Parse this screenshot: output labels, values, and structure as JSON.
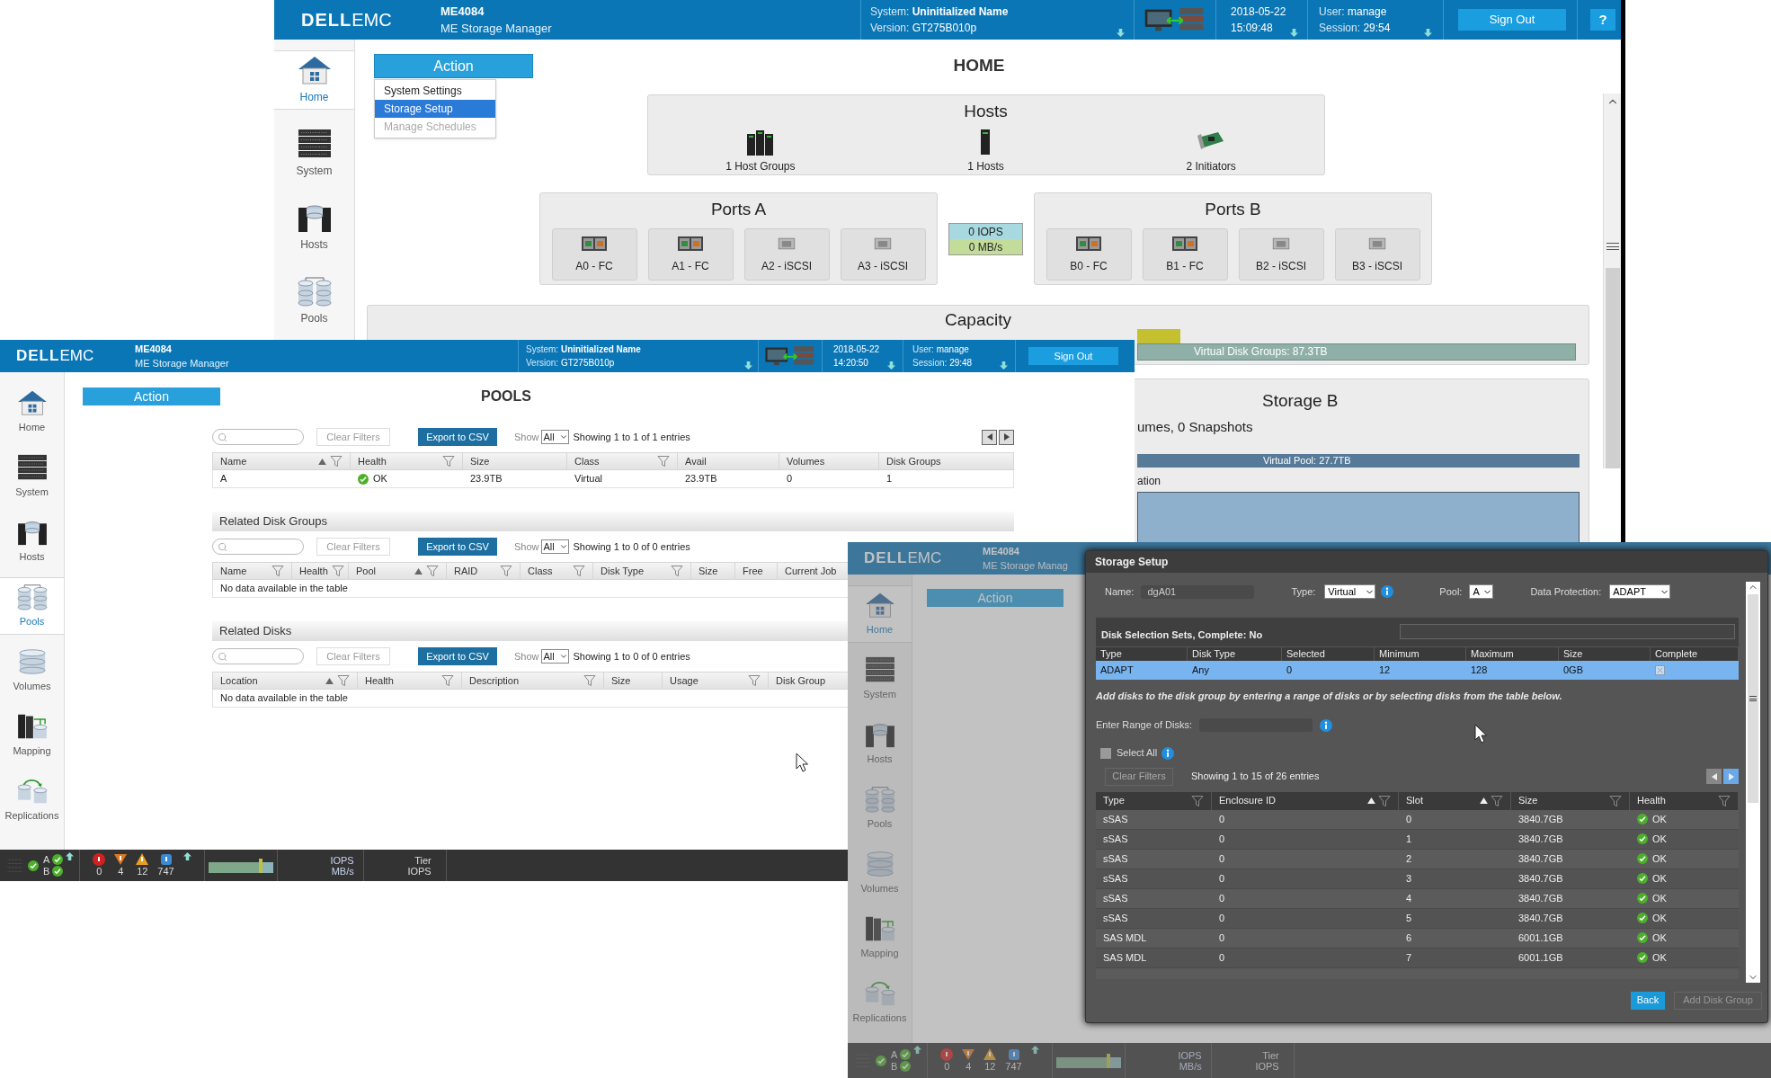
{
  "home_window": {
    "header": {
      "logo_main": "DELL",
      "logo_sub": "EMC",
      "product": "ME4084",
      "subtitle": "ME Storage Manager",
      "system_label": "System:",
      "system_value": "Uninitialized Name",
      "version_label": "Version:",
      "version_value": "GT275B010p",
      "date": "2018-05-22",
      "time": "15:09:48",
      "user_label": "User:",
      "user_value": "manage",
      "session_label": "Session:",
      "session_value": "29:54",
      "sign_out": "Sign Out",
      "help": "?"
    },
    "sidebar": [
      {
        "label": "Home",
        "selected": true
      },
      {
        "label": "System",
        "selected": false
      },
      {
        "label": "Hosts",
        "selected": false
      },
      {
        "label": "Pools",
        "selected": false
      }
    ],
    "action_button": "Action",
    "action_menu": [
      {
        "label": "System Settings",
        "selected": false,
        "disabled": false
      },
      {
        "label": "Storage Setup",
        "selected": true,
        "disabled": false
      },
      {
        "label": "Manage Schedules",
        "selected": false,
        "disabled": true
      }
    ],
    "title": "HOME",
    "hosts": {
      "title": "Hosts",
      "items": [
        {
          "label": "1 Host Groups",
          "kind": "host_group"
        },
        {
          "label": "1 Hosts",
          "kind": "host"
        },
        {
          "label": "2 Initiators",
          "kind": "initiator"
        }
      ]
    },
    "ports_a": {
      "title": "Ports A",
      "ports": [
        {
          "label": "A0 - FC",
          "kind": "fc"
        },
        {
          "label": "A1 - FC",
          "kind": "fc"
        },
        {
          "label": "A2 - iSCSI",
          "kind": "iscsi"
        },
        {
          "label": "A3 - iSCSI",
          "kind": "iscsi"
        }
      ]
    },
    "throughput": {
      "iops": "0 IOPS",
      "bandwidth": "0 MB/s"
    },
    "ports_b": {
      "title": "Ports B",
      "ports": [
        {
          "label": "B0 - FC",
          "kind": "fc"
        },
        {
          "label": "B1 - FC",
          "kind": "fc"
        },
        {
          "label": "B2 - iSCSI",
          "kind": "iscsi"
        },
        {
          "label": "B3 - iSCSI",
          "kind": "iscsi"
        }
      ]
    },
    "capacity": {
      "title": "Capacity",
      "bar": "Virtual Disk Groups: 87.3TB"
    },
    "storage_b": {
      "title": "Storage B",
      "summary": "umes, 0 Snapshots",
      "pool_bar": "Virtual Pool: 27.7TB",
      "section_label": "ation"
    }
  },
  "pools_window": {
    "header": {
      "logo_main": "DELL",
      "logo_sub": "EMC",
      "product": "ME4084",
      "subtitle": "ME Storage Manager",
      "system_label": "System:",
      "system_value": "Uninitialized Name",
      "version_label": "Version:",
      "version_value": "GT275B010p",
      "date": "2018-05-22",
      "time": "14:20:50",
      "user_label": "User:",
      "user_value": "manage",
      "session_label": "Session:",
      "session_value": "29:48",
      "sign_out": "Sign Out"
    },
    "sidebar": [
      {
        "label": "Home",
        "selected": false
      },
      {
        "label": "System",
        "selected": false
      },
      {
        "label": "Hosts",
        "selected": false
      },
      {
        "label": "Pools",
        "selected": true
      },
      {
        "label": "Volumes",
        "selected": false
      },
      {
        "label": "Mapping",
        "selected": false
      },
      {
        "label": "Replications",
        "selected": false
      }
    ],
    "action_button": "Action",
    "title": "POOLS",
    "pools_table": {
      "toolbar": {
        "clear_filters": "Clear Filters",
        "export": "Export to CSV",
        "show_label": "Show",
        "show_value": "All",
        "info": "Showing 1 to 1 of 1 entries"
      },
      "columns": [
        {
          "label": "Name",
          "sorted": true,
          "filter": true,
          "kind": "text"
        },
        {
          "label": "Health",
          "sorted": false,
          "filter": true,
          "kind": "health"
        },
        {
          "label": "Size",
          "sorted": false,
          "filter": false,
          "kind": "text"
        },
        {
          "label": "Class",
          "sorted": false,
          "filter": true,
          "kind": "text"
        },
        {
          "label": "Avail",
          "sorted": false,
          "filter": false,
          "kind": "text"
        },
        {
          "label": "Volumes",
          "sorted": false,
          "filter": false,
          "kind": "text"
        },
        {
          "label": "Disk Groups",
          "sorted": false,
          "filter": false,
          "kind": "text"
        }
      ],
      "rows": [
        [
          "A",
          "OK",
          "23.9TB",
          "Virtual",
          "23.9TB",
          "0",
          "1"
        ]
      ]
    },
    "disk_groups": {
      "title": "Related Disk Groups",
      "toolbar": {
        "clear_filters": "Clear Filters",
        "export": "Export to CSV",
        "show_label": "Show",
        "show_value": "All",
        "info": "Showing 1 to 0 of 0 entries"
      },
      "columns": [
        {
          "label": "Name",
          "sorted": false,
          "filter": true
        },
        {
          "label": "Health",
          "sorted": false,
          "filter": true
        },
        {
          "label": "Pool",
          "sorted": true,
          "filter": true
        },
        {
          "label": "RAID",
          "sorted": false,
          "filter": true
        },
        {
          "label": "Class",
          "sorted": false,
          "filter": true
        },
        {
          "label": "Disk Type",
          "sorted": false,
          "filter": true
        },
        {
          "label": "Size",
          "sorted": false,
          "filter": false
        },
        {
          "label": "Free",
          "sorted": false,
          "filter": false
        },
        {
          "label": "Current Job",
          "sorted": false,
          "filter": false
        }
      ],
      "empty": "No data available in the table"
    },
    "disks": {
      "title": "Related Disks",
      "toolbar": {
        "clear_filters": "Clear Filters",
        "export": "Export to CSV",
        "show_label": "Show",
        "show_value": "All",
        "info": "Showing 1 to 0 of 0 entries"
      },
      "columns": [
        {
          "label": "Location",
          "sorted": true,
          "filter": true
        },
        {
          "label": "Health",
          "sorted": false,
          "filter": true
        },
        {
          "label": "Description",
          "sorted": false,
          "filter": true
        },
        {
          "label": "Size",
          "sorted": false,
          "filter": false
        },
        {
          "label": "Usage",
          "sorted": false,
          "filter": true
        },
        {
          "label": "Disk Group",
          "sorted": false,
          "filter": false
        }
      ],
      "empty": "No data available in the table"
    },
    "status_bar": {
      "controllers": [
        "A",
        "B"
      ],
      "counts": [
        {
          "kind": "error",
          "value": "0"
        },
        {
          "kind": "critical",
          "value": "4"
        },
        {
          "kind": "warning",
          "value": "12"
        },
        {
          "kind": "info",
          "value": "747"
        }
      ],
      "perf": [
        "IOPS",
        "MB/s"
      ],
      "tier": [
        "Tier",
        "IOPS"
      ]
    }
  },
  "setup_window": {
    "header": {
      "logo_main": "DELL",
      "logo_sub": "EMC",
      "product": "ME4084",
      "subtitle": "ME Storage Manag"
    },
    "sidebar": [
      {
        "label": "Home",
        "selected": true
      },
      {
        "label": "System",
        "selected": false
      },
      {
        "label": "Hosts",
        "selected": false
      },
      {
        "label": "Pools",
        "selected": false
      },
      {
        "label": "Volumes",
        "selected": false
      },
      {
        "label": "Mapping",
        "selected": false
      },
      {
        "label": "Replications",
        "selected": false
      }
    ],
    "action_button": "Action",
    "status_bar": {
      "controllers": [
        "A",
        "B"
      ],
      "counts": [
        {
          "kind": "error",
          "value": "0"
        },
        {
          "kind": "critical",
          "value": "4"
        },
        {
          "kind": "warning",
          "value": "12"
        },
        {
          "kind": "info",
          "value": "747"
        }
      ],
      "perf": [
        "IOPS",
        "MB/s"
      ],
      "tier": [
        "Tier",
        "IOPS"
      ]
    },
    "dialog": {
      "title": "Storage Setup",
      "name_label": "Name:",
      "name_value": "dgA01",
      "type_label": "Type:",
      "type_value": "Virtual",
      "pool_label": "Pool:",
      "pool_value": "A",
      "protection_label": "Data Protection:",
      "protection_value": "ADAPT",
      "sets_title": "Disk Selection Sets, Complete: No",
      "sets_columns": [
        "Type",
        "Disk Type",
        "Selected",
        "Minimum",
        "Maximum",
        "Size",
        "Complete"
      ],
      "sets_rows": [
        {
          "cells": [
            "ADAPT",
            "Any",
            "0",
            "12",
            "128",
            "0GB"
          ],
          "complete": false,
          "selected": true
        }
      ],
      "hint": "Add disks to the disk group by entering a range of disks or by selecting disks from the table below.",
      "range_label": "Enter Range of Disks:",
      "select_all": {
        "label": "Select All",
        "checked": false
      },
      "clear_filters": "Clear Filters",
      "info": "Showing 1 to 15 of 26 entries",
      "disk_columns": [
        {
          "label": "Type",
          "sorted": false,
          "filter": true
        },
        {
          "label": "Enclosure ID",
          "sorted": true,
          "filter": true
        },
        {
          "label": "Slot",
          "sorted": true,
          "filter": true
        },
        {
          "label": "Size",
          "sorted": false,
          "filter": true
        },
        {
          "label": "Health",
          "sorted": false,
          "filter": true
        }
      ],
      "disks": [
        {
          "type": "sSAS",
          "enclosure": "0",
          "slot": "0",
          "size": "3840.7GB",
          "health": "OK"
        },
        {
          "type": "sSAS",
          "enclosure": "0",
          "slot": "1",
          "size": "3840.7GB",
          "health": "OK"
        },
        {
          "type": "sSAS",
          "enclosure": "0",
          "slot": "2",
          "size": "3840.7GB",
          "health": "OK"
        },
        {
          "type": "sSAS",
          "enclosure": "0",
          "slot": "3",
          "size": "3840.7GB",
          "health": "OK"
        },
        {
          "type": "sSAS",
          "enclosure": "0",
          "slot": "4",
          "size": "3840.7GB",
          "health": "OK"
        },
        {
          "type": "sSAS",
          "enclosure": "0",
          "slot": "5",
          "size": "3840.7GB",
          "health": "OK"
        },
        {
          "type": "SAS MDL",
          "enclosure": "0",
          "slot": "6",
          "size": "6001.1GB",
          "health": "OK"
        },
        {
          "type": "SAS MDL",
          "enclosure": "0",
          "slot": "7",
          "size": "6001.1GB",
          "health": "OK"
        }
      ],
      "back": "Back",
      "add": {
        "label": "Add Disk Group",
        "disabled": true
      }
    }
  }
}
